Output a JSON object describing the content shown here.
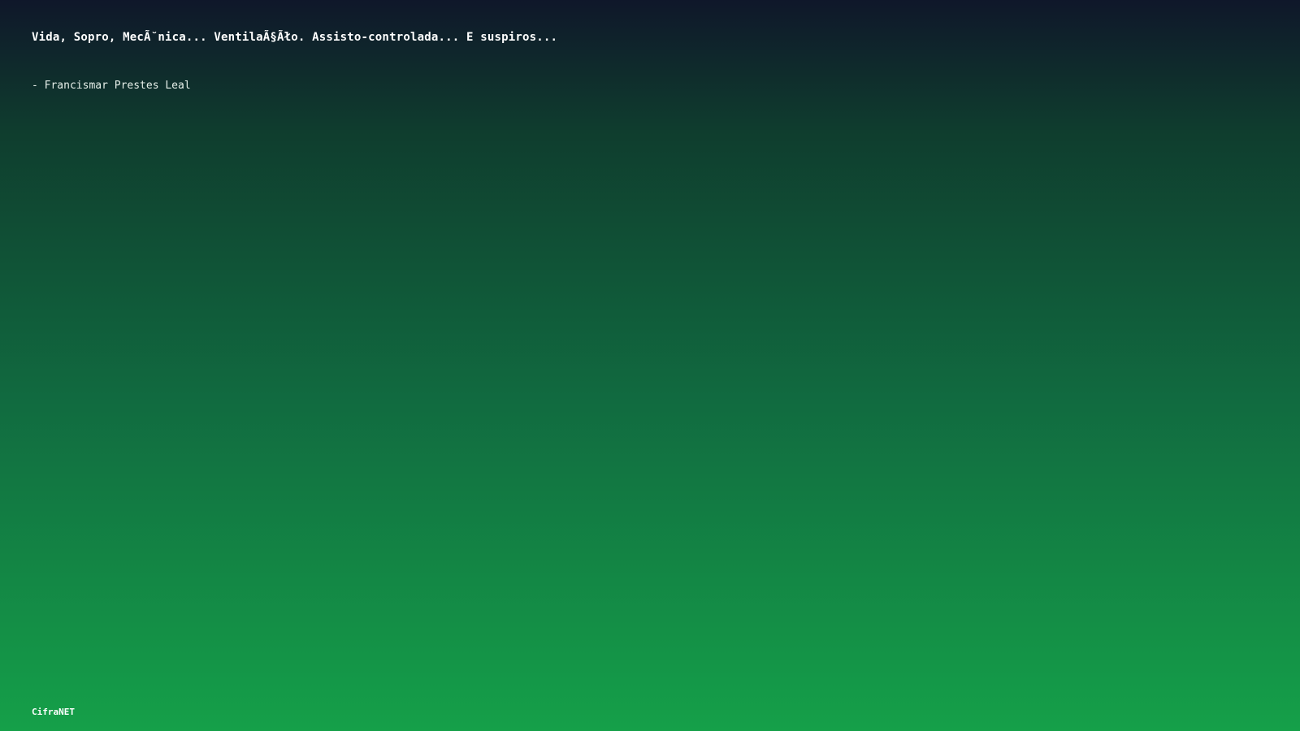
{
  "quote": {
    "text": "Vida, Sopro, MecÃ˘nica... VentilaÃ§Ãło. Assisto-controlada... E suspiros...",
    "author": "- Francismar Prestes Leal"
  },
  "footer": {
    "brand": "CifraNET"
  },
  "colors": {
    "top": "#0f172a",
    "bottom": "#15a049",
    "text": "#ffffff"
  }
}
